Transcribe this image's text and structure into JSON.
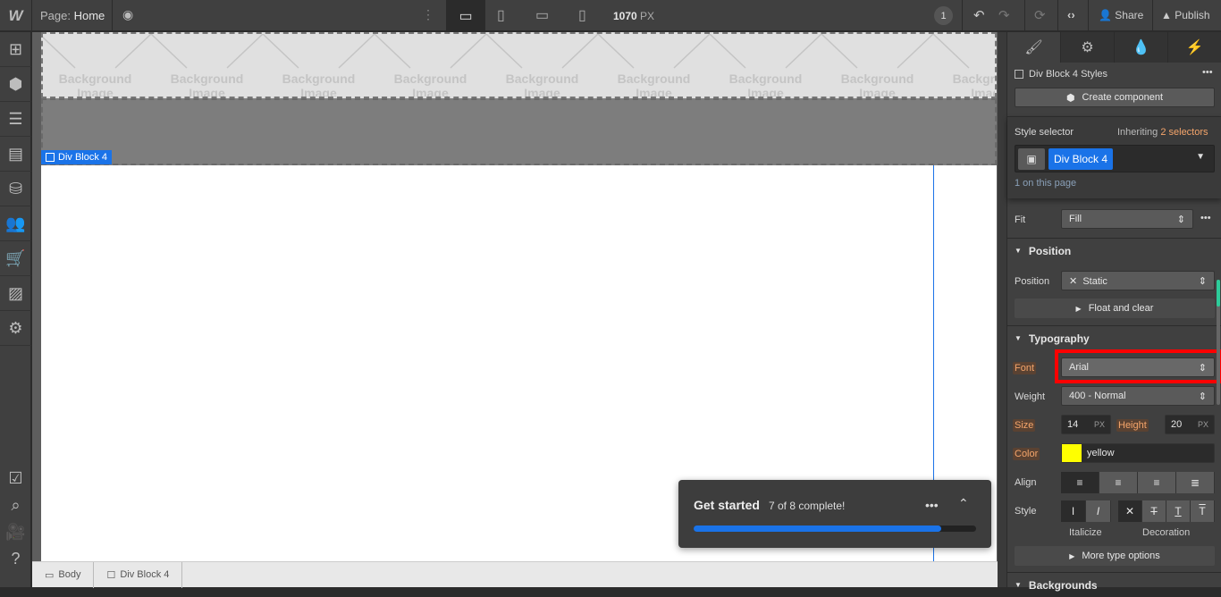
{
  "topbar": {
    "logo": "W",
    "page_label": "Page:",
    "page_name": "Home",
    "width_value": "1070",
    "width_unit": "PX",
    "badge": "1",
    "share": "Share",
    "publish": "Publish"
  },
  "leftbar": {
    "icons": [
      "add-icon",
      "components-icon",
      "navigator-icon",
      "pages-icon",
      "cms-icon",
      "users-icon",
      "ecommerce-icon",
      "assets-icon",
      "settings-icon"
    ],
    "bottom_icons": [
      "tasks-icon",
      "search-icon",
      "video-icon",
      "help-icon"
    ]
  },
  "canvas": {
    "bg_placeholder_line1": "Background",
    "bg_placeholder_line2": "Image",
    "selected_label": "Div Block 4"
  },
  "get_started": {
    "title": "Get started",
    "status": "7 of 8 complete!",
    "progress": 0.875,
    "accent": "#1a73e8"
  },
  "breadcrumb": [
    "Body",
    "Div Block 4"
  ],
  "panel": {
    "styles_title": "Div Block 4 Styles",
    "create_component": "Create component",
    "style_selector_label": "Style selector",
    "inheriting_prefix": "Inheriting",
    "inheriting_count": "2 selectors",
    "selector_chip": "Div Block 4",
    "on_page": "1 on this page",
    "fit_label": "Fit",
    "fit_value": "Fill",
    "position_section": "Position",
    "position_label": "Position",
    "position_value": "Static",
    "float_clear": "Float and clear",
    "typography_section": "Typography",
    "font_label": "Font",
    "font_value": "Arial",
    "weight_label": "Weight",
    "weight_value": "400 - Normal",
    "size_label": "Size",
    "size_value": "14",
    "size_unit": "PX",
    "height_label": "Height",
    "height_value": "20",
    "height_unit": "PX",
    "color_label": "Color",
    "color_value": "yellow",
    "color_swatch": "#ffff00",
    "align_label": "Align",
    "style_label": "Style",
    "italicize": "Italicize",
    "decoration": "Decoration",
    "more_type": "More type options",
    "backgrounds_section": "Backgrounds",
    "highlight_color": "#ff0000"
  }
}
